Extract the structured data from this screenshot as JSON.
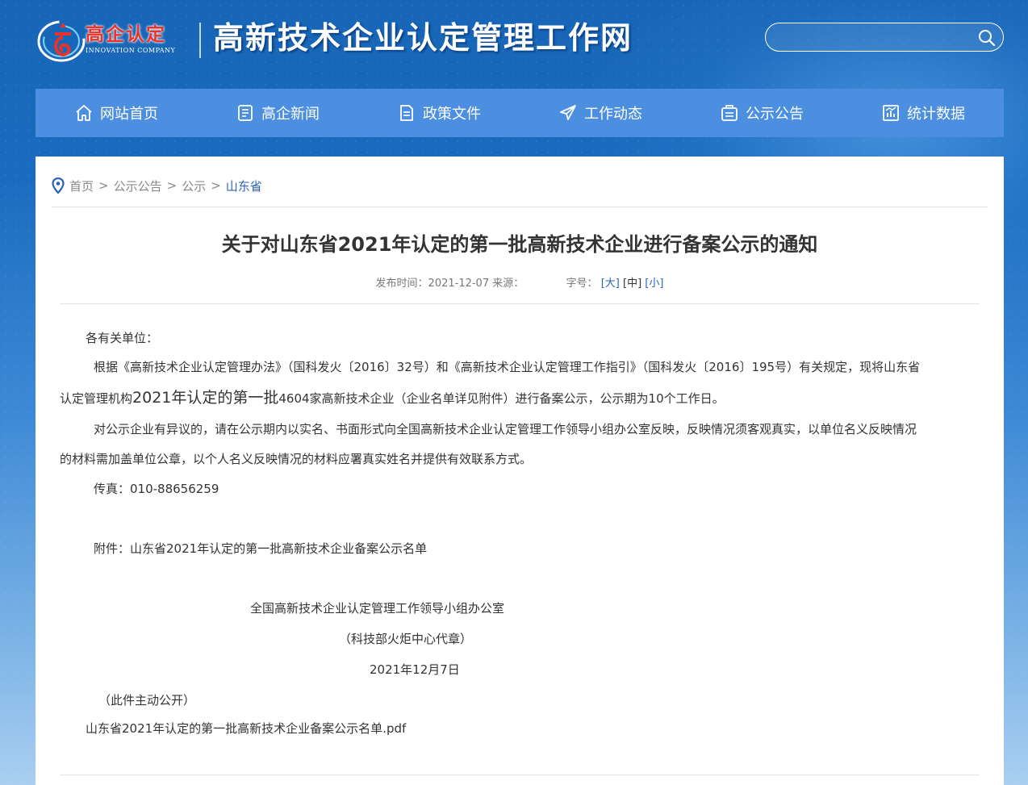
{
  "header": {
    "logo_cn": "高企认定",
    "logo_en": "INNOVATION COMPANY",
    "site_title": "高新技术企业认定管理工作网",
    "search_placeholder": ""
  },
  "nav": {
    "items": [
      {
        "label": "网站首页",
        "icon": "home-icon"
      },
      {
        "label": "高企新闻",
        "icon": "news-icon"
      },
      {
        "label": "政策文件",
        "icon": "document-icon"
      },
      {
        "label": "工作动态",
        "icon": "paper-plane-icon"
      },
      {
        "label": "公示公告",
        "icon": "notice-icon"
      },
      {
        "label": "统计数据",
        "icon": "chart-icon"
      }
    ]
  },
  "breadcrumb": {
    "items": [
      "首页",
      "公示公告",
      "公示",
      "山东省"
    ],
    "separator": ">"
  },
  "article": {
    "title": "关于对山东省2021年认定的第一批高新技术企业进行备案公示的通知",
    "meta": {
      "publish_label": "发布时间：",
      "publish_date": "2021-12-07",
      "source_label": "来源：",
      "fontsize_label": "字号：",
      "size_large": "[大]",
      "size_medium": "[中]",
      "size_small": "[小]"
    },
    "greeting": "各有关单位：",
    "para1_line1": "根据《高新技术企业认定管理办法》（国科发火〔2016〕32号）和《高新技术企业认定管理工作指引》（国科发火〔2016〕195号）有关规定，现将山东省",
    "para1_line2_a": "认定管理机构",
    "para1_line2_b": "2021年认定的第一批",
    "para1_line2_c": "4604家高新技术企业（企业名单详见附件）进行备案公示，公示期为10个工作日。",
    "para2_line1": "对公示企业有异议的，请在公示期内以实名、书面形式向全国高新技术企业认定管理工作领导小组办公室反映，反映情况须客观真实，以单位名义反映情况",
    "para2_line2": "的材料需加盖单位公章，以个人名义反映情况的材料应署真实姓名并提供有效联系方式。",
    "fax": "传真：010-88656259",
    "attachment_note": "附件：山东省2021年认定的第一批高新技术企业备案公示名单",
    "signature_org": "全国高新技术企业认定管理工作领导小组办公室",
    "signature_proxy": "（科技部火炬中心代章）",
    "signature_date": "2021年12月7日",
    "disclosure": "（此件主动公开）",
    "attachment_file": "山东省2021年认定的第一批高新技术企业备案公示名单.pdf"
  },
  "colors": {
    "nav_bg": "#4c8fe0",
    "link_blue": "#2a63b8",
    "logo_red": "#e8332a"
  }
}
